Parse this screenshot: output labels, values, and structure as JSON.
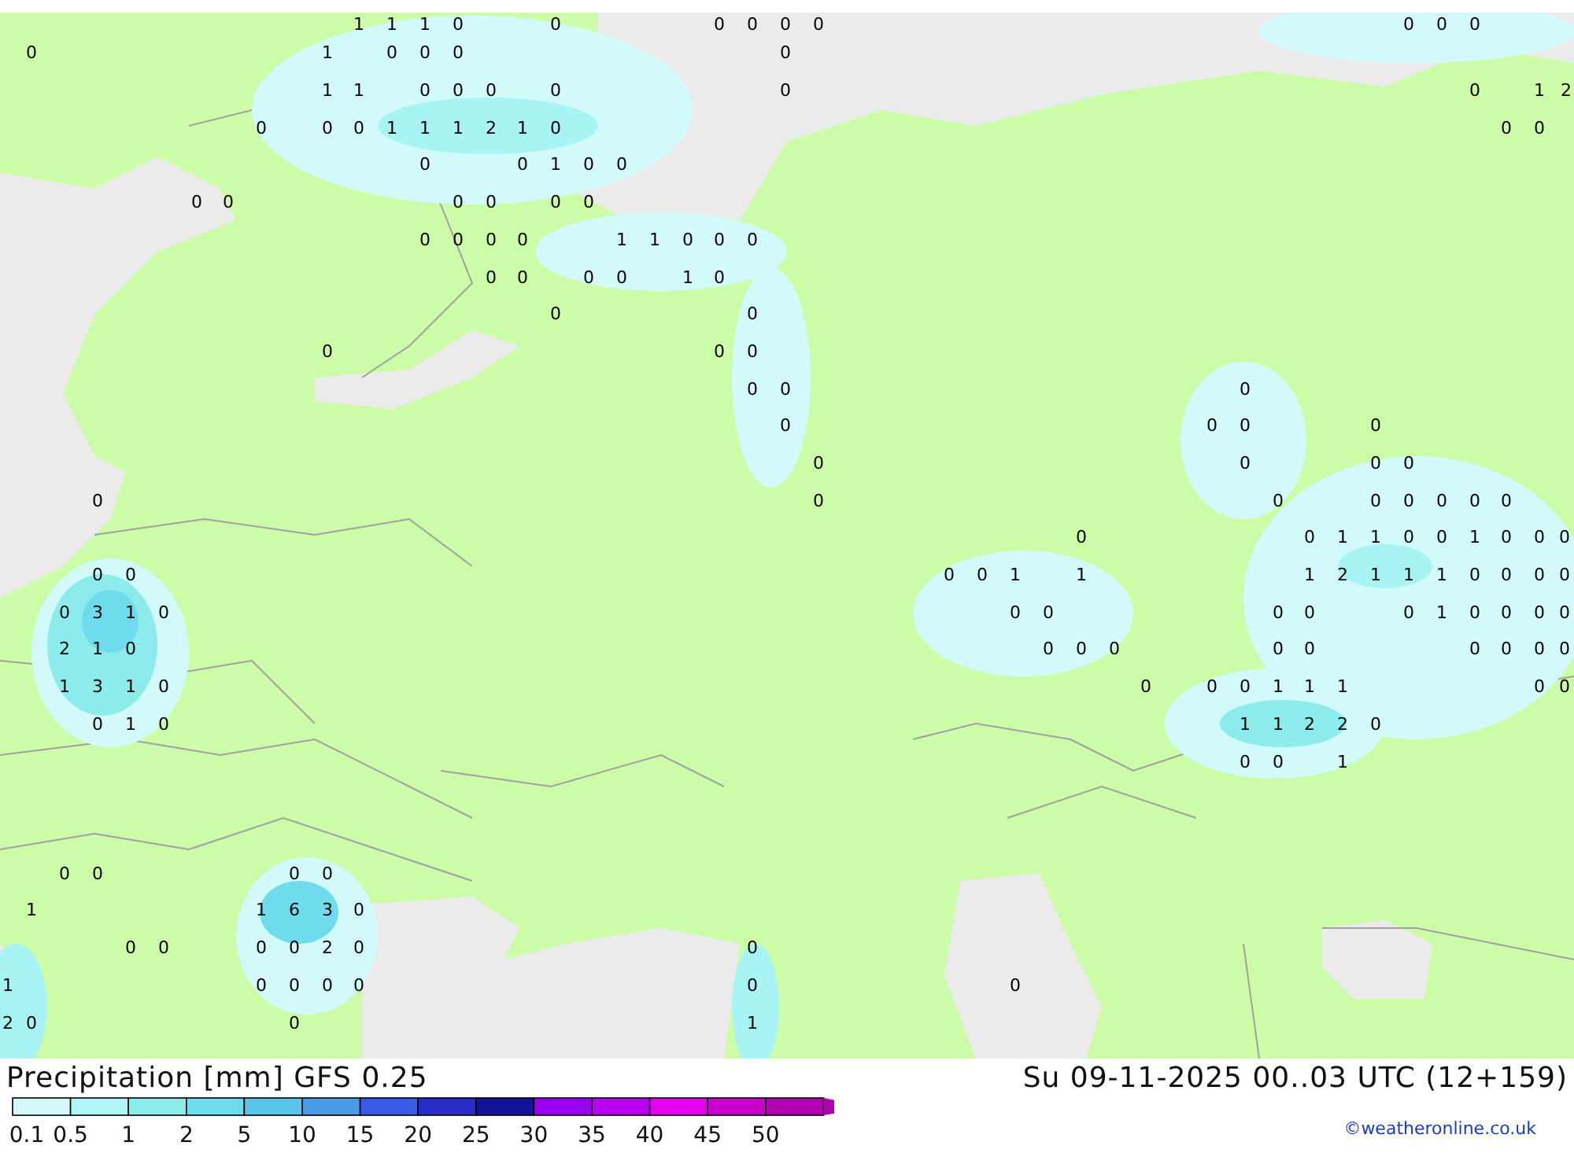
{
  "map": {
    "values": [
      "1",
      "1",
      "1",
      "0",
      "0",
      "0",
      "0",
      "0",
      "0",
      "0",
      "0",
      "0",
      "0",
      "1",
      "0",
      "0",
      "0",
      "0",
      "1",
      "1",
      "0",
      "0",
      "0",
      "0",
      "0",
      "0",
      "1",
      "2",
      "0",
      "0",
      "0",
      "1",
      "1",
      "1",
      "2",
      "1",
      "0",
      "0",
      "0",
      "0",
      "0",
      "1",
      "0",
      "0",
      "0",
      "0",
      "0",
      "0",
      "0",
      "0",
      "0",
      "0",
      "0",
      "0",
      "1",
      "1",
      "0",
      "0",
      "0",
      "0",
      "0",
      "0",
      "0",
      "1",
      "0",
      "0",
      "0",
      "0",
      "0",
      "0",
      "0",
      "0",
      "0",
      "0",
      "0",
      "0",
      "0",
      "0",
      "0",
      "0",
      "0",
      "0",
      "0",
      "0",
      "0",
      "0",
      "0",
      "0",
      "0",
      "0",
      "0",
      "1",
      "1",
      "0",
      "0",
      "1",
      "0",
      "0",
      "0",
      "0",
      "0",
      "0",
      "0",
      "1",
      "1",
      "1",
      "2",
      "1",
      "1",
      "1",
      "0",
      "0",
      "0",
      "0",
      "0",
      "3",
      "1",
      "0",
      "0",
      "0",
      "0",
      "0",
      "0",
      "1",
      "0",
      "0",
      "0",
      "0",
      "2",
      "1",
      "0",
      "0",
      "0",
      "0",
      "0",
      "0",
      "0",
      "0",
      "0",
      "0",
      "1",
      "3",
      "1",
      "0",
      "0",
      "0",
      "0",
      "1",
      "1",
      "1",
      "0",
      "0",
      "0",
      "1",
      "0",
      "1",
      "1",
      "2",
      "2",
      "0",
      "0",
      "0",
      "1",
      "0",
      "0",
      "0",
      "0",
      "1",
      "1",
      "6",
      "3",
      "0",
      "0",
      "0",
      "0",
      "0",
      "2",
      "0",
      "0",
      "1",
      "0",
      "0",
      "0",
      "0",
      "0",
      "0",
      "2",
      "0",
      "0",
      "1"
    ]
  },
  "title": "Precipitation [mm] GFS 0.25",
  "valid_time": "Su 09-11-2025 00..03 UTC (12+159)",
  "legend": {
    "bins": [
      {
        "color": "#d2fafa"
      },
      {
        "color": "#aef6f6"
      },
      {
        "color": "#8cecec"
      },
      {
        "color": "#6edcec"
      },
      {
        "color": "#5ac4ea"
      },
      {
        "color": "#4a9ce8"
      },
      {
        "color": "#3a5ae8"
      },
      {
        "color": "#2a2ac8"
      },
      {
        "color": "#12129c"
      },
      {
        "color": "#9a00f0"
      },
      {
        "color": "#ba00f0"
      },
      {
        "color": "#e600f0"
      },
      {
        "color": "#cc00cc"
      },
      {
        "color": "#b000b0"
      }
    ],
    "labels": [
      "0.1",
      "0.5",
      "1",
      "2",
      "5",
      "10",
      "15",
      "20",
      "25",
      "30",
      "35",
      "40",
      "45",
      "50"
    ]
  },
  "credit": "©weatheronline.co.uk"
}
